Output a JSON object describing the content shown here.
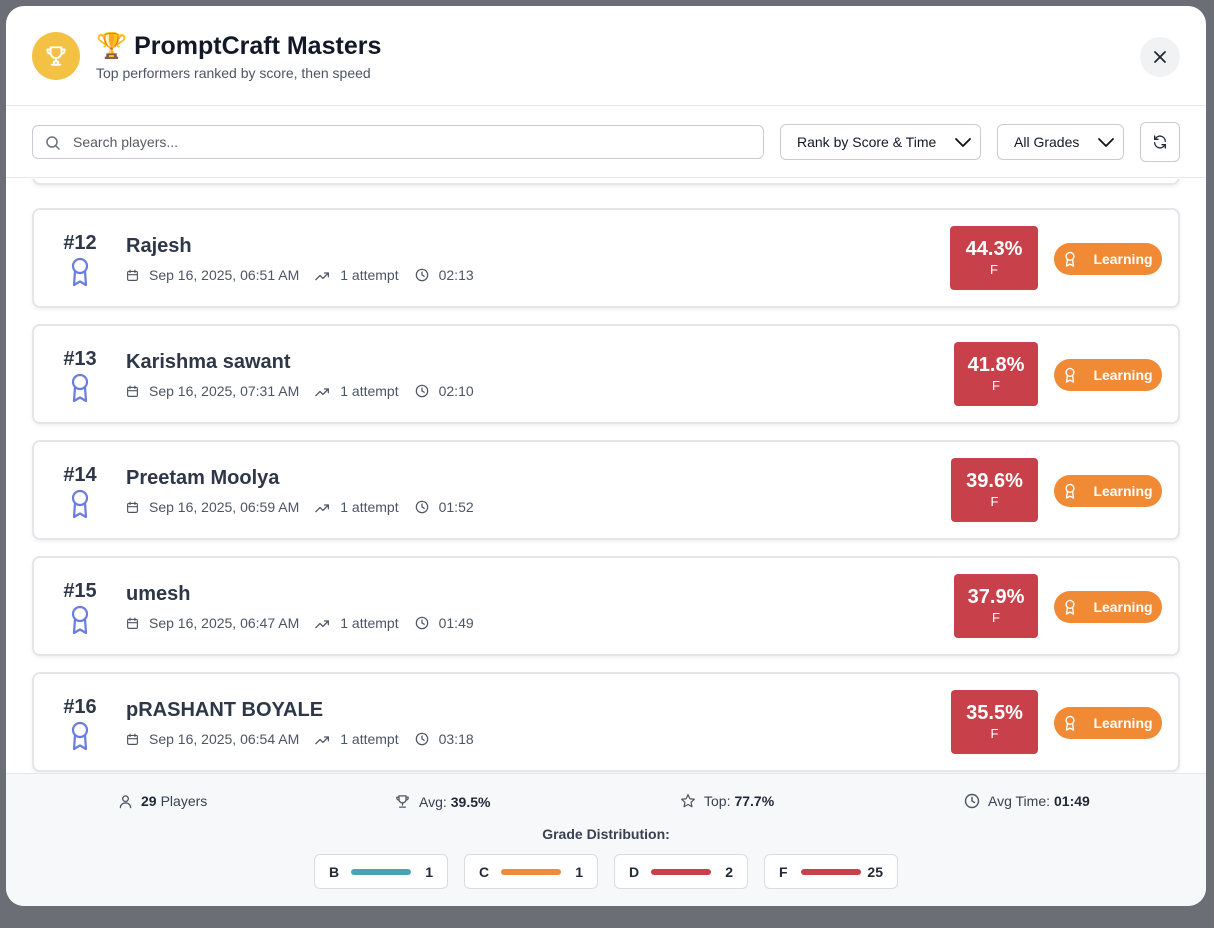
{
  "header": {
    "title": "🏆 PromptCraft Masters",
    "subtitle": "Top performers ranked by score, then speed"
  },
  "toolbar": {
    "search_placeholder": "Search players...",
    "sort_value": "Rank by Score & Time",
    "grade_value": "All Grades"
  },
  "players": [
    {
      "rank": "#12",
      "name": "Rajesh",
      "date": "Sep 16, 2025, 06:51 AM",
      "attempts": "1 attempt",
      "time": "02:13",
      "score": "44.3%",
      "grade": "F",
      "badge": "Learning"
    },
    {
      "rank": "#13",
      "name": "Karishma sawant",
      "date": "Sep 16, 2025, 07:31 AM",
      "attempts": "1 attempt",
      "time": "02:10",
      "score": "41.8%",
      "grade": "F",
      "badge": "Learning"
    },
    {
      "rank": "#14",
      "name": "Preetam Moolya",
      "date": "Sep 16, 2025, 06:59 AM",
      "attempts": "1 attempt",
      "time": "01:52",
      "score": "39.6%",
      "grade": "F",
      "badge": "Learning"
    },
    {
      "rank": "#15",
      "name": "umesh",
      "date": "Sep 16, 2025, 06:47 AM",
      "attempts": "1 attempt",
      "time": "01:49",
      "score": "37.9%",
      "grade": "F",
      "badge": "Learning"
    },
    {
      "rank": "#16",
      "name": "pRASHANT BOYALE",
      "date": "Sep 16, 2025, 06:54 AM",
      "attempts": "1 attempt",
      "time": "03:18",
      "score": "35.5%",
      "grade": "F",
      "badge": "Learning"
    }
  ],
  "footer": {
    "players_count": "29",
    "players_label": "Players",
    "avg_label": "Avg:",
    "avg_value": "39.5%",
    "top_label": "Top:",
    "top_value": "77.7%",
    "avg_time_label": "Avg Time:",
    "avg_time_value": "01:49",
    "distribution_title": "Grade Distribution:",
    "distribution": [
      {
        "grade": "B",
        "count": "1",
        "color": "#4aa3b5"
      },
      {
        "grade": "C",
        "count": "1",
        "color": "#ef8a3c"
      },
      {
        "grade": "D",
        "count": "2",
        "color": "#c8404a"
      },
      {
        "grade": "F",
        "count": "25",
        "color": "#c8404a"
      }
    ]
  },
  "colors": {
    "score_fail": "#c8404a",
    "badge_learning": "#f08a35",
    "logo": "#f3c143",
    "ribbon": "#6b7ce0"
  }
}
